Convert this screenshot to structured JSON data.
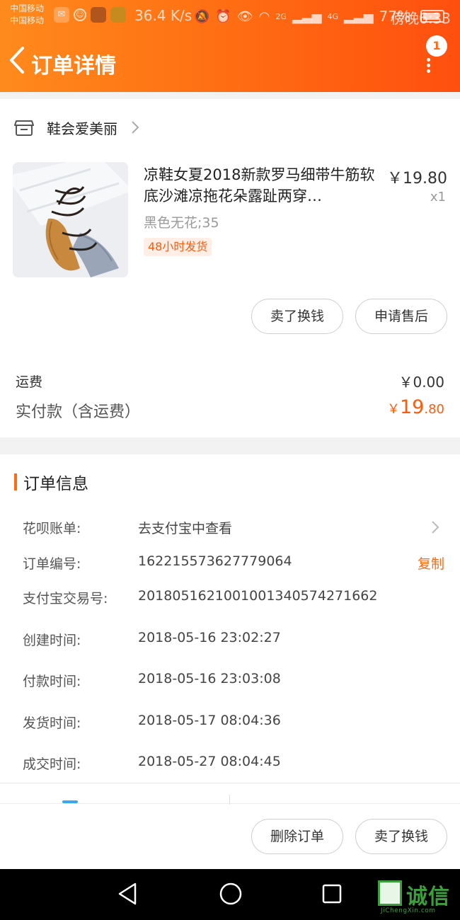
{
  "status_bar": {
    "carrier_1": "中国移动",
    "carrier_2": "中国移动",
    "speed": "36.4 K/s",
    "network_1": "2G",
    "network_2": "4G",
    "battery": "77%",
    "time": "傍晚6:33"
  },
  "header": {
    "title": "订单详情",
    "badge_count": "1",
    "gradient": [
      "#ff8a1c",
      "#ff4f0f"
    ]
  },
  "store": {
    "name": "鞋会爱美丽"
  },
  "product": {
    "title": "凉鞋女夏2018新款罗马细带牛筋软底沙滩凉拖花朵露趾两穿…",
    "price": "￥19.80",
    "quantity": "x1",
    "sku": "黑色无花;35",
    "ship_tag": "48小时发货"
  },
  "actions_top": {
    "sell_label": "卖了换钱",
    "after_sale_label": "申请售后"
  },
  "summary": {
    "freight_label": "运费",
    "freight_value": "￥0.00",
    "paid_label": "实付款（含运费）",
    "paid_currency": "￥",
    "paid_int": "19",
    "paid_dec": ".80"
  },
  "order_info": {
    "title": "订单信息",
    "rows": [
      {
        "label": "花呗账单:",
        "value": "去支付宝中查看"
      },
      {
        "label": "订单编号:",
        "value": "162215573627779064",
        "action": "复制"
      },
      {
        "label": "支付宝交易号:",
        "value": "2018051621001001340574271662"
      },
      {
        "label": "创建时间:",
        "value": "2018-05-16 23:02:27"
      },
      {
        "label": "付款时间:",
        "value": "2018-05-16 23:03:08"
      },
      {
        "label": "发货时间:",
        "value": "2018-05-17 08:04:36"
      },
      {
        "label": "成交时间:",
        "value": "2018-05-27 08:04:45"
      }
    ]
  },
  "bottom_actions": {
    "delete_label": "删除订单",
    "sell_label": "卖了换钱"
  },
  "watermark": {
    "text": "诚信",
    "sub": "JiChengXin.com"
  },
  "colors": {
    "accent": "#ff6a12",
    "price_highlight": "#ff5a0a"
  }
}
